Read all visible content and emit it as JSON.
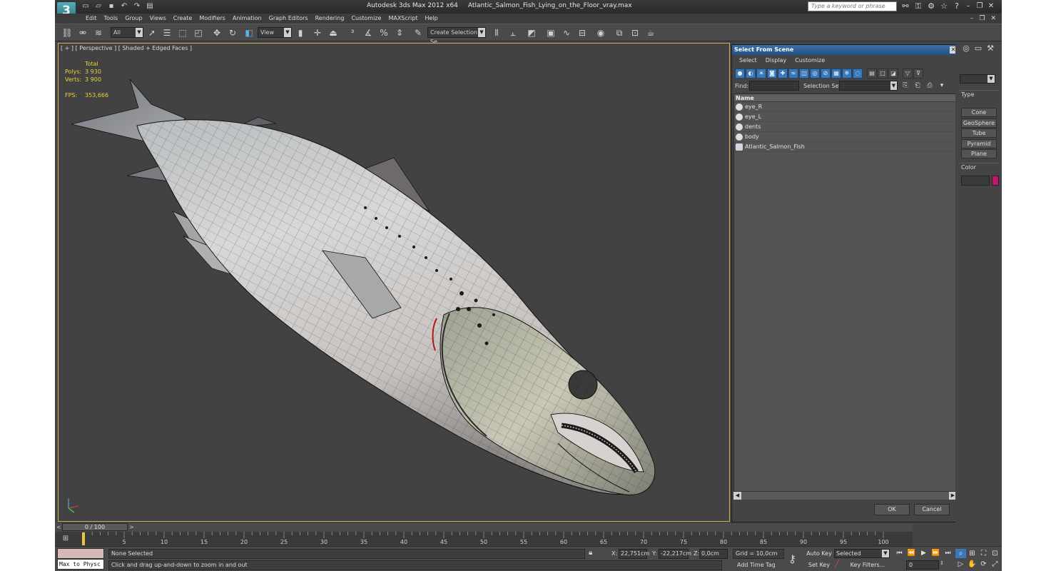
{
  "app": {
    "logo": "3",
    "title_app": "Autodesk 3ds Max  2012 x64",
    "title_file": "Atlantic_Salmon_Fish_Lying_on_the_Floor_vray.max",
    "search_placeholder": "Type a keyword or phrase"
  },
  "menu": [
    "Edit",
    "Tools",
    "Group",
    "Views",
    "Create",
    "Modifiers",
    "Animation",
    "Graph Editors",
    "Rendering",
    "Customize",
    "MAXScript",
    "Help"
  ],
  "toolbar": {
    "filter_value": "All",
    "refcoord_value": "View",
    "named_sel_value": "Create Selection Se"
  },
  "viewport": {
    "label": "[ + ] [ Perspective ] [ Shaded + Edged Faces ]",
    "stats": {
      "total_label": "Total",
      "polys_label": "Polys:",
      "polys_value": "3 930",
      "verts_label": "Verts:",
      "verts_value": "3 900",
      "fps_label": "FPS:",
      "fps_value": "353,666"
    },
    "object_color": "#c9c9c9",
    "wire_color": "#1a1a1a"
  },
  "command_panel": {
    "type_label": "Type",
    "buttons": [
      "Cone",
      "GeoSphere",
      "Tube",
      "Pyramid",
      "Plane"
    ],
    "color_label": "Color",
    "object_color": "#c0166e"
  },
  "dialog": {
    "title": "Select From Scene",
    "menu": [
      "Select",
      "Display",
      "Customize"
    ],
    "find_label": "Find:",
    "selset_label": "Selection Set:",
    "column_name": "Name",
    "items": [
      {
        "name": "eye_R",
        "kind": "object"
      },
      {
        "name": "eye_L",
        "kind": "object"
      },
      {
        "name": "dents",
        "kind": "object"
      },
      {
        "name": "body",
        "kind": "object"
      },
      {
        "name": "Atlantic_Salmon_Fish",
        "kind": "group"
      }
    ],
    "ok_label": "OK",
    "cancel_label": "Cancel"
  },
  "timeline": {
    "slider_label": "0 / 100",
    "ticks": [
      5,
      10,
      15,
      20,
      25,
      30,
      35,
      40,
      45,
      50,
      55,
      60,
      65,
      70,
      75,
      80,
      85,
      90,
      95,
      100
    ],
    "max_frame": 100
  },
  "status": {
    "script_text": "Max to Physc",
    "selection": "None Selected",
    "prompt": "Click and drag up-and-down to zoom in and out",
    "x_label": "X:",
    "x_value": "22,751cm",
    "y_label": "Y:",
    "y_value": "-22,217cm",
    "z_label": "Z:",
    "z_value": "0,0cm",
    "grid": "Grid = 10,0cm",
    "add_time_tag": "Add Time Tag",
    "auto_key": "Auto Key",
    "set_key": "Set Key",
    "selected_value": "Selected",
    "key_filters": "Key Filters...",
    "current_frame": "0"
  }
}
